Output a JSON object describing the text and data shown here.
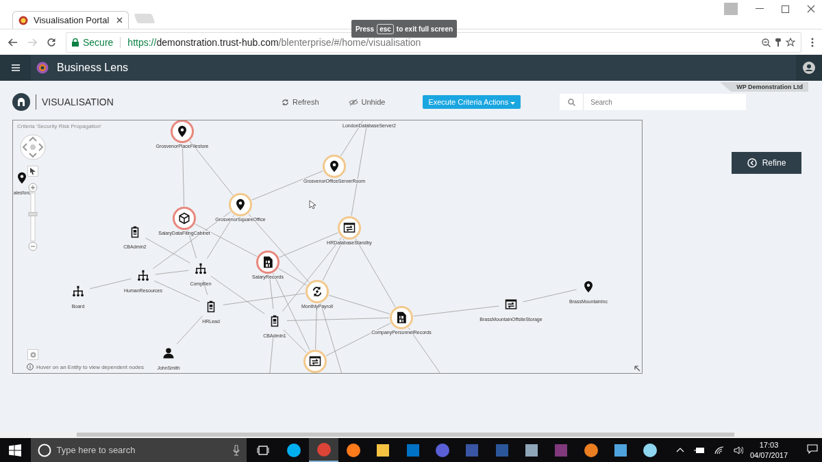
{
  "browser": {
    "tab_title": "Visualisation Portal",
    "secure_label": "Secure",
    "url_scheme": "https://",
    "url_host": "demonstration.trust-hub.com",
    "url_path": "/blenterprise/#/home/visualisation",
    "fullscreen_hint": {
      "before": "Press",
      "key": "esc",
      "after": "to exit full screen"
    }
  },
  "app_bar": {
    "title": "Business Lens"
  },
  "org_tag": "WP Demonstration Ltd",
  "page": {
    "title": "VISUALISATION",
    "actions": [
      {
        "label": "Refresh",
        "kind": "refresh"
      },
      {
        "label": "Unhide",
        "kind": "unhide"
      }
    ],
    "execute_button": "Execute Criteria Actions",
    "search": {
      "placeholder": "Search"
    }
  },
  "graph": {
    "zoom": {
      "level": 0.6
    },
    "criteria": "Criteria 'Security Risk Propagation'",
    "hint": "Hover on an Entity to view dependent nodes",
    "nodes": [
      {
        "label": "GrosvenorPlaceFilestore",
        "kind": "pin",
        "color": "#e8877d"
      },
      {
        "label": "LondonDatabaseServer2"
      },
      {
        "label": "GrosvenorOfficeServerRoom",
        "kind": "pin",
        "color": "#f2c88c"
      },
      {
        "label": "GrosvenorSquareOffice",
        "kind": "pin",
        "color": "#f2c88c"
      },
      {
        "label": "SalaryDataFilingCabinet",
        "kind": "cube",
        "color": "#e8877d"
      },
      {
        "label": "HRDatabaseStandby",
        "kind": "server",
        "color": "#f2c88c"
      },
      {
        "label": "CBAdmin2",
        "kind": "badge"
      },
      {
        "label": "SalaryRecords",
        "kind": "file",
        "color": "#e8877d"
      },
      {
        "label": "CompBen",
        "kind": "org"
      },
      {
        "label": "HumanResources",
        "kind": "org"
      },
      {
        "label": "Board",
        "kind": "org"
      },
      {
        "label": "MonthlyPayroll",
        "kind": "sync",
        "color": "#f2c88c"
      },
      {
        "label": "HRLead",
        "kind": "badge"
      },
      {
        "label": "CBAdmin1",
        "kind": "badge"
      },
      {
        "label": "CompanyPersonnelRecords",
        "kind": "file",
        "color": "#f2c88c"
      },
      {
        "label": "BrassMountainOffsiteStorage",
        "kind": "server"
      },
      {
        "label": "BrassMountainInc",
        "kind": "pin"
      },
      {
        "label": "JohnSmith",
        "kind": "person"
      },
      {
        "kind": "server",
        "color": "#f2c88c"
      },
      {
        "label": "alesforc",
        "kind": "pin"
      }
    ]
  },
  "refine_button": "Refine",
  "taskbar": {
    "search_placeholder": "Type here to search",
    "apps": [
      {
        "kind": "chat",
        "selected": false
      },
      {
        "kind": "browser",
        "selected": true
      },
      {
        "kind": "fox",
        "selected": false
      },
      {
        "kind": "folder",
        "selected": false
      },
      {
        "kind": "mail",
        "selected": false
      },
      {
        "kind": "knot",
        "selected": false
      },
      {
        "kind": "diagram",
        "selected": false
      },
      {
        "kind": "doc",
        "selected": false
      },
      {
        "kind": "editor",
        "selected": false
      },
      {
        "kind": "notes",
        "selected": false
      },
      {
        "kind": "vpn",
        "selected": false
      },
      {
        "kind": "photo",
        "selected": false
      },
      {
        "kind": "flake",
        "selected": false
      }
    ],
    "time": "17:03",
    "date": "04/07/2017"
  }
}
